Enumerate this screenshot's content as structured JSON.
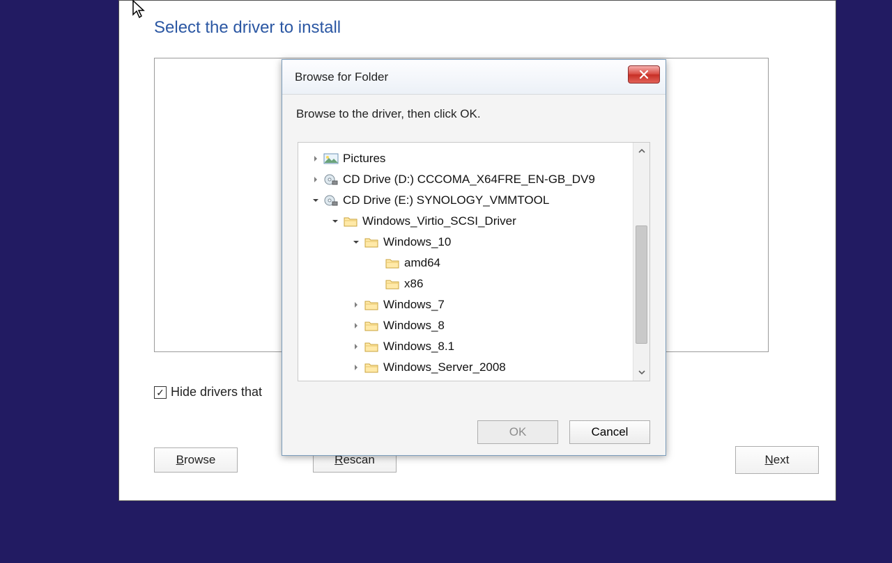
{
  "page": {
    "title": "Select the driver to install",
    "hide_checkbox_label": "Hide drivers that",
    "hide_checked": true,
    "browse_label": "Browse",
    "rescan_label": "Rescan",
    "next_label": "Next"
  },
  "dialog": {
    "title": "Browse for Folder",
    "instruction": "Browse to the driver, then click OK.",
    "ok_label": "OK",
    "ok_enabled": false,
    "cancel_label": "Cancel"
  },
  "tree": [
    {
      "level": 0,
      "caret": "right",
      "icon": "picture",
      "label": "Pictures"
    },
    {
      "level": 0,
      "caret": "right",
      "icon": "cd",
      "label": "CD Drive (D:) CCCOMA_X64FRE_EN-GB_DV9"
    },
    {
      "level": 0,
      "caret": "down",
      "icon": "cd",
      "label": "CD Drive (E:) SYNOLOGY_VMMTOOL"
    },
    {
      "level": 1,
      "caret": "down",
      "icon": "folder",
      "label": "Windows_Virtio_SCSI_Driver"
    },
    {
      "level": 2,
      "caret": "down",
      "icon": "folder",
      "label": "Windows_10"
    },
    {
      "level": 3,
      "caret": "blank",
      "icon": "folder",
      "label": "amd64"
    },
    {
      "level": 3,
      "caret": "blank",
      "icon": "folder",
      "label": "x86"
    },
    {
      "level": 2,
      "caret": "right",
      "icon": "folder",
      "label": "Windows_7"
    },
    {
      "level": 2,
      "caret": "right",
      "icon": "folder",
      "label": "Windows_8"
    },
    {
      "level": 2,
      "caret": "right",
      "icon": "folder",
      "label": "Windows_8.1"
    },
    {
      "level": 2,
      "caret": "right",
      "icon": "folder",
      "label": "Windows_Server_2008"
    }
  ]
}
